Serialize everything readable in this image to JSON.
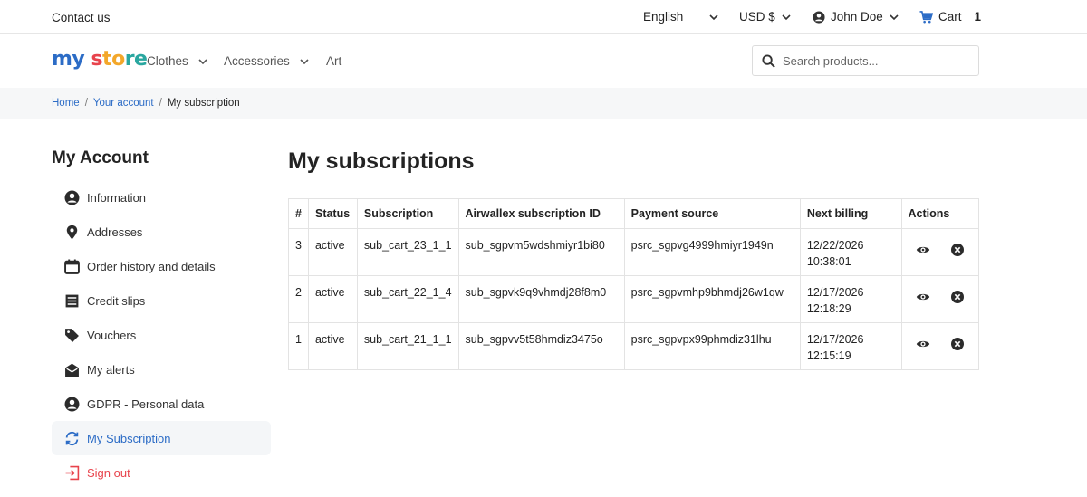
{
  "topbar": {
    "contact": "Contact us",
    "language": "English",
    "currency": "USD $",
    "user": "John Doe",
    "cart_label": "Cart",
    "cart_count": "1"
  },
  "header": {
    "logo_text": [
      "my",
      " ",
      "s",
      "to",
      "re"
    ],
    "nav": [
      "Clothes",
      "Accessories",
      "Art"
    ],
    "search_placeholder": "Search products..."
  },
  "breadcrumb": {
    "home": "Home",
    "account": "Your account",
    "current": "My subscription"
  },
  "sidebar": {
    "title": "My Account",
    "items": [
      {
        "label": "Information",
        "icon": "user-circle-icon"
      },
      {
        "label": "Addresses",
        "icon": "location-pin-icon"
      },
      {
        "label": "Order history and details",
        "icon": "calendar-icon"
      },
      {
        "label": "Credit slips",
        "icon": "document-lines-icon"
      },
      {
        "label": "Vouchers",
        "icon": "tag-icon"
      },
      {
        "label": "My alerts",
        "icon": "envelope-open-icon"
      },
      {
        "label": "GDPR - Personal data",
        "icon": "user-circle-icon"
      },
      {
        "label": "My Subscription",
        "icon": "sync-icon"
      },
      {
        "label": "Sign out",
        "icon": "sign-out-icon"
      }
    ]
  },
  "main": {
    "title": "My subscriptions",
    "columns": [
      "#",
      "Status",
      "Subscription",
      "Airwallex subscription ID",
      "Payment source",
      "Next billing",
      "Actions"
    ],
    "rows": [
      {
        "num": "3",
        "status": "active",
        "subscription": "sub_cart_23_1_1",
        "airwallex_id": "sub_sgpvm5wdshmiyr1bi80",
        "payment_source": "psrc_sgpvg4999hmiyr1949n",
        "next_date": "12/22/2026",
        "next_time": "10:38:01"
      },
      {
        "num": "2",
        "status": "active",
        "subscription": "sub_cart_22_1_4",
        "airwallex_id": "sub_sgpvk9q9vhmdj28f8m0",
        "payment_source": "psrc_sgpvmhp9bhmdj26w1qw",
        "next_date": "12/17/2026",
        "next_time": "12:18:29"
      },
      {
        "num": "1",
        "status": "active",
        "subscription": "sub_cart_21_1_1",
        "airwallex_id": "sub_sgpvv5t58hmdiz3475o",
        "payment_source": "psrc_sgpvpx99phmdiz31lhu",
        "next_date": "12/17/2026",
        "next_time": "12:15:19"
      }
    ]
  },
  "colors": {
    "accent": "#2c6cc6",
    "danger": "#e8434c"
  }
}
